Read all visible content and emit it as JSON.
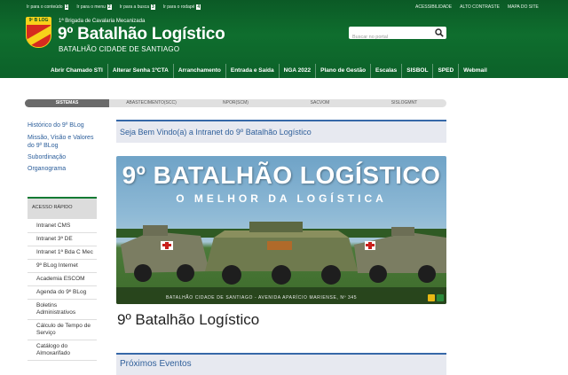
{
  "accessibility": {
    "skip_links": [
      {
        "label": "Ir para o conteúdo",
        "key": "1"
      },
      {
        "label": "Ir para o menu",
        "key": "2"
      },
      {
        "label": "Ir para a busca",
        "key": "3"
      },
      {
        "label": "Ir para o rodapé",
        "key": "4"
      }
    ],
    "util_links": [
      "ACESSIBILIDADE",
      "ALTO CONTRASTE",
      "MAPA DO SITE"
    ]
  },
  "header": {
    "logo_text": "9º B LOG",
    "brigada": "1ª Brigada de Cavalaria Mecanizada",
    "title": "9º Batalhão Logístico",
    "subtitle": "BATALHÃO CIDADE DE SANTIAGO",
    "search_placeholder": "Buscar no portal"
  },
  "nav": [
    "Abrir Chamado STI",
    "Alterar Senha 1ºCTA",
    "Arranchamento",
    "Entrada e Saída",
    "NGA 2022",
    "Plano de Gestão",
    "Escalas",
    "SISBOL",
    "SPED",
    "Webmail"
  ],
  "tabs": [
    "SISTEMAS",
    "ABASTECIMENTO(SCC)",
    "NPOR(SCM)",
    "SACVOM",
    "SISLOGMNT"
  ],
  "sidebar": {
    "links": [
      "Histórico do 9º BLog",
      "Missão, Visão e Valores do 9º BLog",
      "Subordinação",
      "Organograma"
    ],
    "quick_title": "ACESSO RÁPIDO",
    "quick_items": [
      "Intranet CMS",
      "Intranet 3ª DE",
      "Intranet 1ª Bda C Mec",
      "9º BLog Internet",
      "Academia ESCOM",
      "Agenda do 9º BLog",
      "Boletins Administrativos",
      "Cálculo de Tempo de Serviço",
      "Catálogo do Almoxarifado"
    ]
  },
  "main": {
    "welcome": "Seja Bem Vindo(a) a Intranet do 9º Batalhão Logístico",
    "banner_title": "9º BATALHÃO LOGÍSTICO",
    "banner_sub": "O MELHOR DA LOGÍSTICA",
    "banner_footer": "BATALHÃO CIDADE DE SANTIAGO - AVENIDA APARÍCIO MARIENSE, Nº 345",
    "page_heading": "9º Batalhão Logístico",
    "events_heading": "Próximos Eventos"
  },
  "colors": {
    "header_green": "#0f6e2e",
    "link_blue": "#2a5d9a",
    "accent_blue": "#3668a8",
    "banner_ctrl_yellow": "#e8b814",
    "banner_ctrl_green": "#2a8a3a"
  }
}
